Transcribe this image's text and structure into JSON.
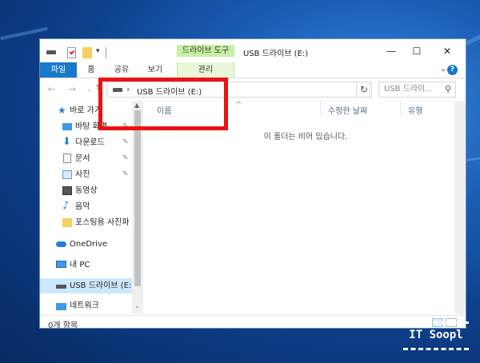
{
  "window": {
    "title": "USB 드라이브 (E:)",
    "contextual_tab": "드라이브 도구",
    "controls": {
      "minimize": "—",
      "maximize": "☐",
      "close": "✕"
    }
  },
  "ribbon": {
    "tabs": [
      "파일",
      "홈",
      "공유",
      "보기",
      "관리"
    ],
    "collapse": "⌄",
    "help": "?"
  },
  "address": {
    "separator": "›",
    "path": "USB 드라이브 (E:)",
    "dropdown": "⌄",
    "refresh": "↻",
    "search_placeholder": "USB 드라이...",
    "nav_back": "←",
    "nav_forward": "→"
  },
  "nav": {
    "items": [
      {
        "label": "바로 가기",
        "icon": "star-icon"
      },
      {
        "label": "바탕 화면",
        "icon": "desktop-icon",
        "pin": "📌"
      },
      {
        "label": "다운로드",
        "icon": "download-icon",
        "pin": "📌"
      },
      {
        "label": "문서",
        "icon": "document-icon",
        "pin": "📌"
      },
      {
        "label": "사진",
        "icon": "pictures-icon",
        "pin": "📌"
      },
      {
        "label": "동영상",
        "icon": "video-icon"
      },
      {
        "label": "음악",
        "icon": "music-icon"
      },
      {
        "label": "포스팅용 사진파",
        "icon": "folder-icon"
      },
      {
        "label": "OneDrive",
        "icon": "cloud-icon"
      },
      {
        "label": "내 PC",
        "icon": "pc-icon"
      },
      {
        "label": "USB 드라이브 (E:)",
        "icon": "usb-drive-icon"
      },
      {
        "label": "네트워크",
        "icon": "network-icon"
      }
    ],
    "scroll_up": "▲",
    "scroll_down": "⌄"
  },
  "content": {
    "columns": [
      "이름",
      "수정한 날짜",
      "유형"
    ],
    "sort_indicator": "^",
    "empty_message": "이 폴더는 비어 있습니다."
  },
  "status": {
    "count": "0개 항목"
  },
  "watermark": "IT Soopl",
  "colors": {
    "accent": "#1979ca",
    "tool_tab": "#c8efa4",
    "highlight": "#ee1111",
    "selection": "#cce8ff"
  }
}
